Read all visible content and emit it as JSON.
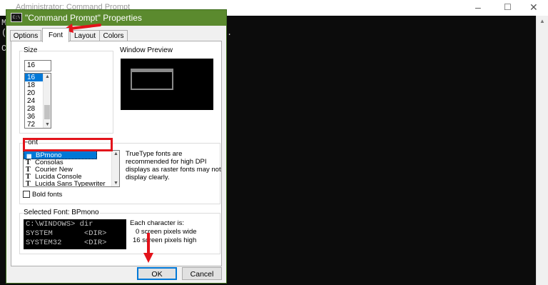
{
  "background_window": {
    "title": "Administrator: Command Prompt",
    "console_lines": [
      "Mi",
      "(c",
      "C:"
    ],
    "console_tail": "."
  },
  "dialog": {
    "title": "\"Command Prompt\" Properties",
    "tabs": [
      {
        "label": "Options"
      },
      {
        "label": "Font"
      },
      {
        "label": "Layout"
      },
      {
        "label": "Colors"
      }
    ],
    "active_tab": "Font"
  },
  "size": {
    "label": "Size",
    "value": "16",
    "options": [
      "16",
      "18",
      "20",
      "24",
      "28",
      "36",
      "72"
    ],
    "selected": "16"
  },
  "preview": {
    "label": "Window Preview"
  },
  "font": {
    "label": "Font",
    "items": [
      {
        "name": "BPmono",
        "icon": "ttf-icon",
        "selected": true
      },
      {
        "name": "Consolas",
        "icon": "truetype-icon"
      },
      {
        "name": "Courier New",
        "icon": "truetype-icon"
      },
      {
        "name": "Lucida Console",
        "icon": "truetype-icon"
      },
      {
        "name": "Lucida Sans Typewriter",
        "icon": "truetype-icon"
      }
    ],
    "note": "TrueType fonts are recommended for high DPI displays as raster fonts may not display clearly.",
    "bold_label": "Bold fonts",
    "bold_checked": false
  },
  "selected_font": {
    "label": "Selected Font: BPmono",
    "sample_lines": [
      "C:\\WINDOWS> dir",
      "SYSTEM       <DIR>",
      "SYSTEM32     <DIR>"
    ],
    "char_title": "Each character is:",
    "width_text": "0 screen pixels wide",
    "height_text": "16 screen pixels high"
  },
  "buttons": {
    "ok": "OK",
    "cancel": "Cancel"
  },
  "colors": {
    "titlebar": "#5b8a2e",
    "selection": "#0078d7",
    "annotation": "#e3131b"
  }
}
